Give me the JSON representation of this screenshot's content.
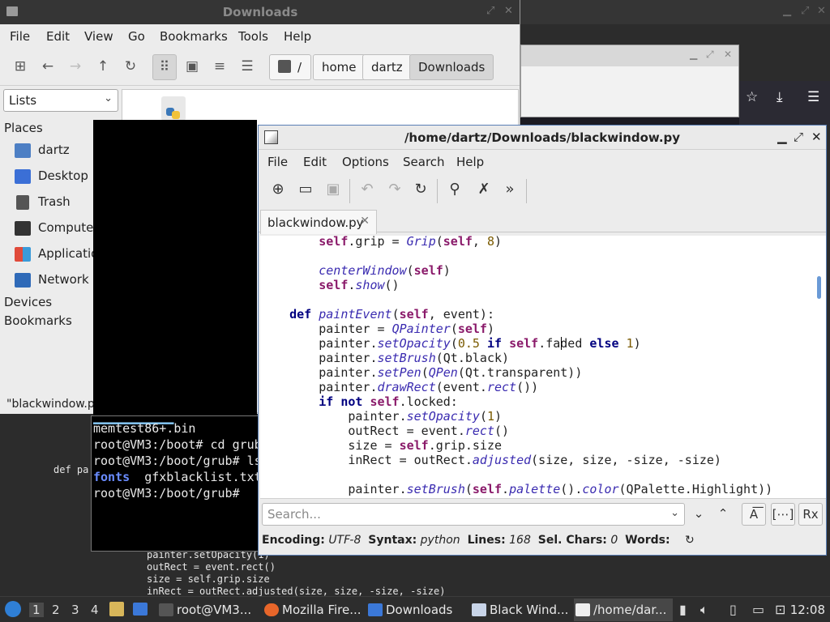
{
  "file_manager": {
    "title": "Downloads",
    "menu": [
      "File",
      "Edit",
      "View",
      "Go",
      "Bookmarks",
      "Tools",
      "Help"
    ],
    "path": [
      "/",
      "home",
      "dartz",
      "Downloads"
    ],
    "side_pane_mode": "Lists",
    "places_heading": "Places",
    "places": [
      "dartz",
      "Desktop",
      "Trash",
      "Computer",
      "Applications",
      "Network"
    ],
    "devices_heading": "Devices",
    "bookmarks_heading": "Bookmarks",
    "status": "\"blackwindow.py\""
  },
  "terminal": {
    "lines": [
      "memtest86+.bin",
      "root@VM3:/boot# cd grub",
      "root@VM3:/boot/grub# ls",
      "gfxblacklist.txt",
      "root@VM3:/boot/grub# "
    ],
    "dir_entry": "fonts"
  },
  "background_code": {
    "def_line": "def pa",
    "lines": [
      "painter.setOpacity(1)",
      "outRect = event.rect()",
      "size = self.grip.size",
      "inRect = outRect.adjusted(size, size, -size, -size)"
    ]
  },
  "editor": {
    "title": "/home/dartz/Downloads/blackwindow.py",
    "menu": [
      "File",
      "Edit",
      "Options",
      "Search",
      "Help"
    ],
    "tab": "blackwindow.py",
    "search_placeholder": "Search...",
    "status": {
      "encoding_label": "Encoding:",
      "encoding": "UTF-8",
      "syntax_label": "Syntax:",
      "syntax": "python",
      "lines_label": "Lines:",
      "lines": "168",
      "sel_label": "Sel. Chars:",
      "sel": "0",
      "words_label": "Words:"
    },
    "code": [
      "        self.grip = Grip(self, 8)",
      "",
      "        centerWindow(self)",
      "        self.show()",
      "",
      "    def paintEvent(self, event):",
      "        painter = QPainter(self)",
      "        painter.setOpacity(0.5 if self.faded else 1)",
      "        painter.setBrush(Qt.black)",
      "        painter.setPen(QPen(Qt.transparent))",
      "        painter.drawRect(event.rect())",
      "        if not self.locked:",
      "            painter.setOpacity(1)",
      "            outRect = event.rect()",
      "            size = self.grip.size",
      "            inRect = outRect.adjusted(size, size, -size, -size)",
      "",
      "            painter.setBrush(self.palette().color(QPalette.Highlight))"
    ]
  },
  "taskbar": {
    "workspaces": [
      "1",
      "2",
      "3",
      "4"
    ],
    "tasks": [
      "root@VM3...",
      "Mozilla Fire...",
      "Downloads",
      "Black Wind...",
      "/home/dar..."
    ],
    "clock": "12:08"
  }
}
